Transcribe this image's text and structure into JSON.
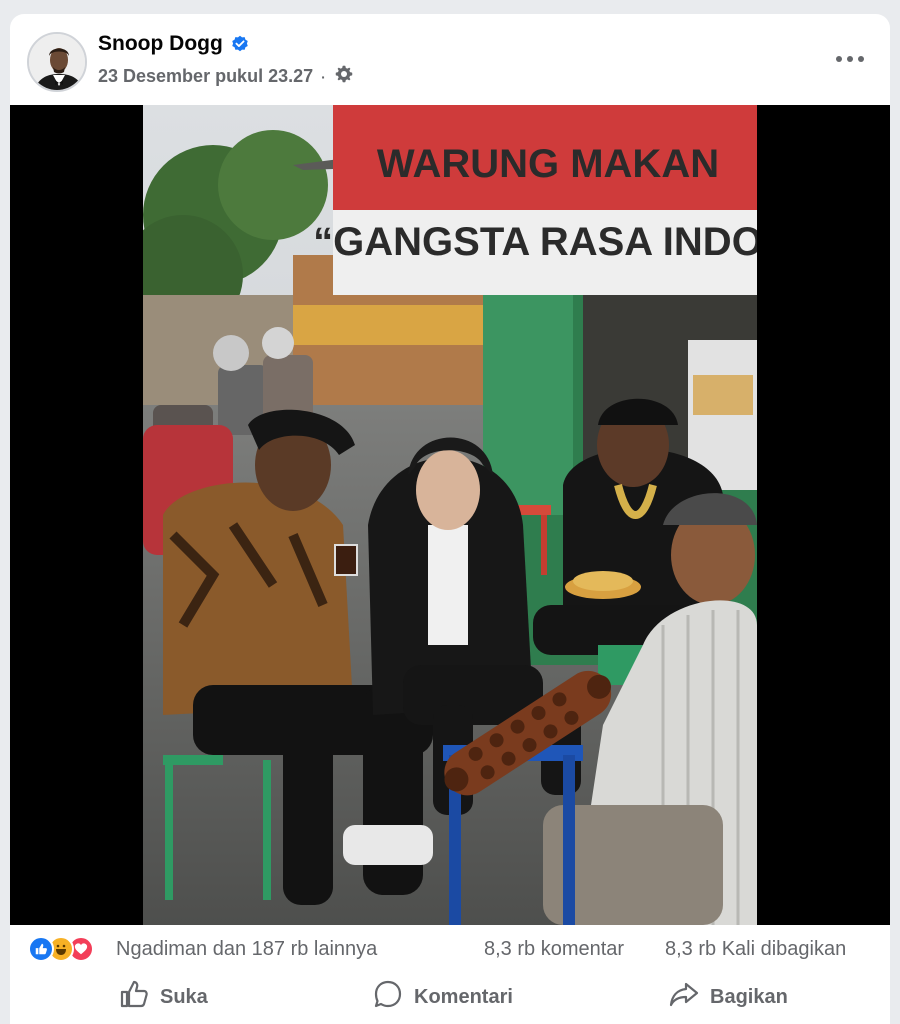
{
  "post": {
    "author": "Snoop Dogg",
    "timestamp": "23 Desember pukul 23.27",
    "meta_separator": "·",
    "more_label": "•••"
  },
  "photo": {
    "banner_line1": "WARUNG MAKAN",
    "banner_line2": "“GANGSTA RASA INDO”"
  },
  "stats": {
    "reactions_text": "Ngadiman dan 187 rb lainnya",
    "comments_text": "8,3 rb komentar",
    "shares_text": "8,3 rb Kali dibagikan"
  },
  "actions": {
    "like_label": "Suka",
    "comment_label": "Komentari",
    "share_label": "Bagikan"
  },
  "icons": {
    "verified": "verified-badge-icon",
    "privacy": "gear-icon",
    "like": "thumbs-up-icon",
    "comment": "comment-bubble-icon",
    "share": "share-arrow-icon"
  },
  "colors": {
    "brand_blue": "#1877f2",
    "secondary_text": "#65676b",
    "love_red": "#f33e58",
    "haha_yellow": "#f7b125"
  }
}
